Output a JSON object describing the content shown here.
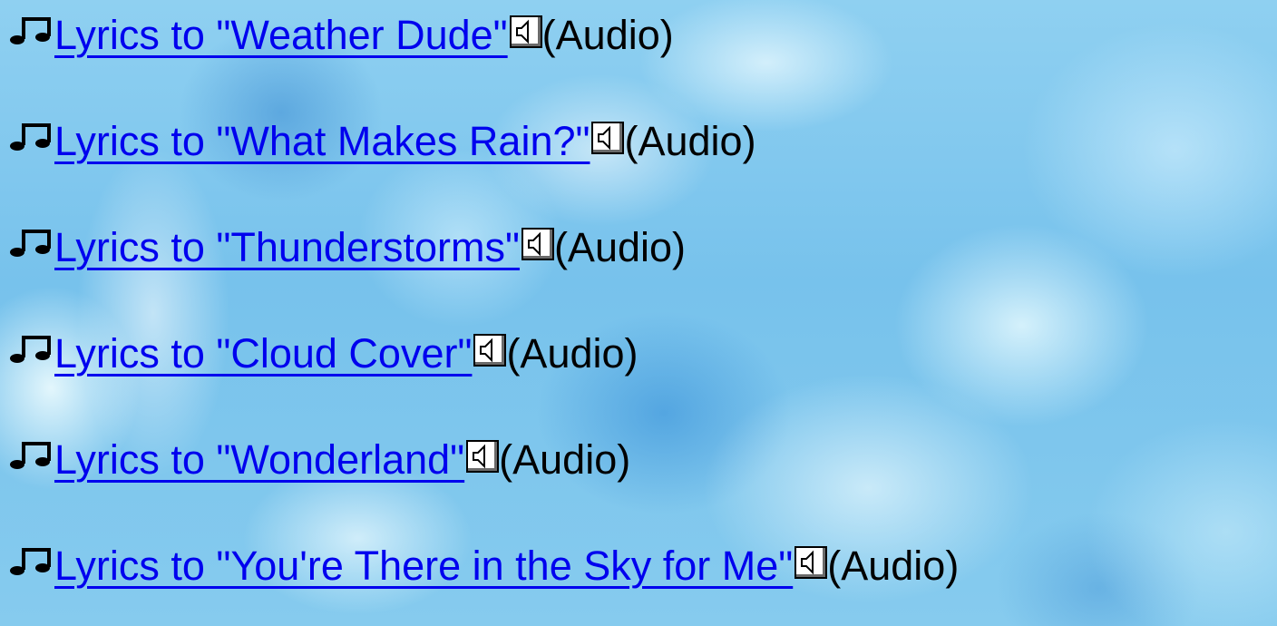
{
  "songs": [
    {
      "link_text": "Lyrics to \"Weather Dude\"",
      "audio_label": "(Audio)",
      "note_icon": "music-note-icon",
      "audio_icon": "speaker-icon"
    },
    {
      "link_text": "Lyrics to \"What Makes Rain?\"",
      "audio_label": "(Audio)",
      "note_icon": "music-note-icon",
      "audio_icon": "speaker-icon"
    },
    {
      "link_text": "Lyrics to \"Thunderstorms\"",
      "audio_label": "(Audio)",
      "note_icon": "music-note-icon",
      "audio_icon": "speaker-icon"
    },
    {
      "link_text": "Lyrics to \"Cloud Cover\"",
      "audio_label": "(Audio)",
      "note_icon": "music-note-icon",
      "audio_icon": "speaker-icon"
    },
    {
      "link_text": "Lyrics to \"Wonderland\"",
      "audio_label": "(Audio)",
      "note_icon": "music-note-icon",
      "audio_icon": "speaker-icon"
    },
    {
      "link_text": "Lyrics to \"You're There in the Sky for Me\"",
      "audio_label": "(Audio)",
      "note_icon": "music-note-icon",
      "audio_icon": "speaker-icon"
    }
  ],
  "colors": {
    "link": "#0000ee",
    "text": "#000000",
    "sky": "#7cc6ee"
  }
}
